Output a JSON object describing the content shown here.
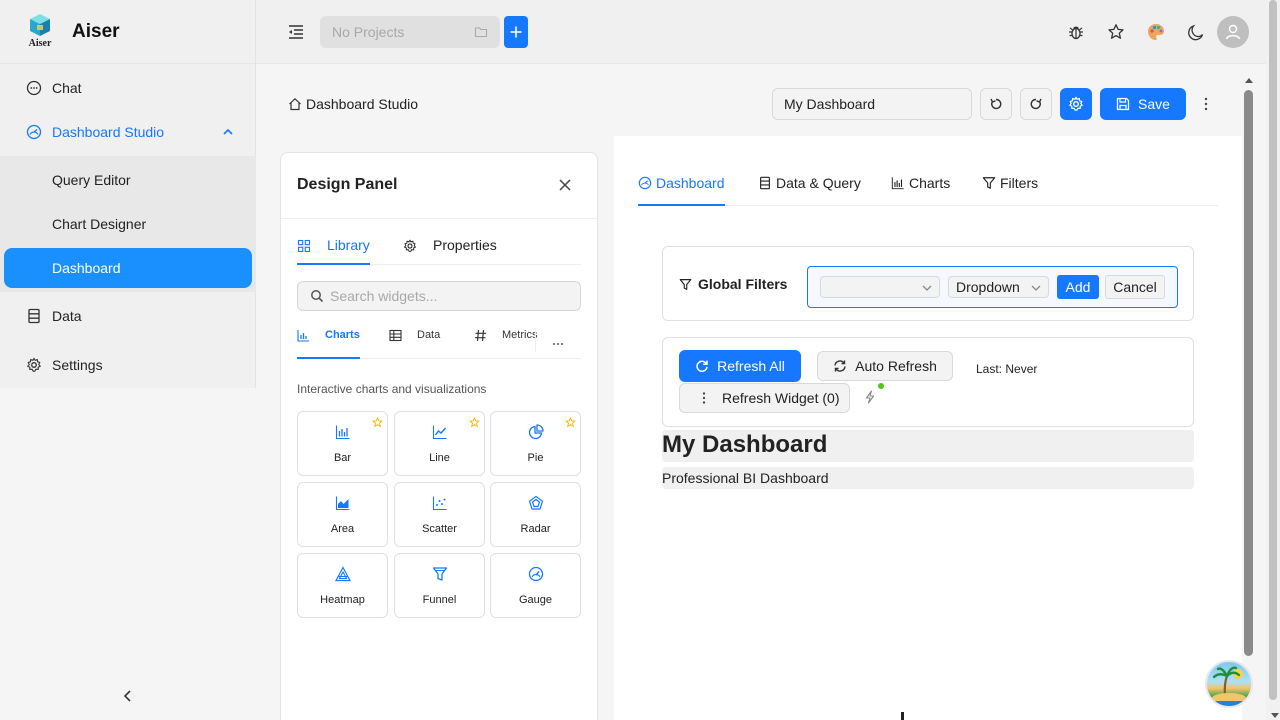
{
  "app": {
    "brand": "Aiser",
    "logo_subtext": "Aiser"
  },
  "sidebar": {
    "items": [
      {
        "label": "Chat",
        "icon": "chat-icon"
      },
      {
        "label": "Dashboard Studio",
        "icon": "dashboard-gauge-icon",
        "expanded": true
      },
      {
        "label": "Data",
        "icon": "database-icon"
      },
      {
        "label": "Settings",
        "icon": "gear-icon"
      }
    ],
    "submenu": [
      {
        "label": "Query Editor"
      },
      {
        "label": "Chart Designer"
      },
      {
        "label": "Dashboard",
        "selected": true
      }
    ]
  },
  "topbar": {
    "project_placeholder": "No Projects"
  },
  "header": {
    "breadcrumb": "Dashboard Studio",
    "dashboard_name": "My Dashboard",
    "save_label": "Save"
  },
  "design_panel": {
    "title": "Design Panel",
    "tabs": [
      {
        "label": "Library",
        "active": true
      },
      {
        "label": "Properties"
      }
    ],
    "search_placeholder": "Search widgets...",
    "categories": [
      {
        "label": "Charts",
        "active": true
      },
      {
        "label": "Data"
      },
      {
        "label": "Metrics"
      }
    ],
    "description": "Interactive charts and visualizations",
    "widgets": [
      {
        "label": "Bar",
        "icon": "bar-chart-icon",
        "starred": true
      },
      {
        "label": "Line",
        "icon": "line-chart-icon",
        "starred": true
      },
      {
        "label": "Pie",
        "icon": "pie-chart-icon",
        "starred": true
      },
      {
        "label": "Area",
        "icon": "area-chart-icon",
        "starred": false
      },
      {
        "label": "Scatter",
        "icon": "scatter-chart-icon",
        "starred": false
      },
      {
        "label": "Radar",
        "icon": "radar-chart-icon",
        "starred": false
      },
      {
        "label": "Heatmap",
        "icon": "heatmap-icon",
        "starred": false
      },
      {
        "label": "Funnel",
        "icon": "funnel-icon",
        "starred": false
      },
      {
        "label": "Gauge",
        "icon": "gauge-icon",
        "starred": false
      }
    ]
  },
  "dashboard": {
    "tabs": [
      {
        "label": "Dashboard",
        "active": true
      },
      {
        "label": "Data & Query"
      },
      {
        "label": "Charts"
      },
      {
        "label": "Filters"
      }
    ],
    "global_filters": {
      "label": "Global Filters",
      "field_value": "",
      "type_value": "Dropdown",
      "add_label": "Add",
      "cancel_label": "Cancel"
    },
    "controls": {
      "refresh_all": "Refresh All",
      "auto_refresh": "Auto Refresh",
      "last_refresh": "Last: Never",
      "refresh_widget": "Refresh Widget (0)"
    },
    "title": "My Dashboard",
    "subtitle": "Professional BI Dashboard"
  },
  "colors": {
    "accent": "#1677ff",
    "selected_nav": "#1a90ff",
    "star": "#f0b400",
    "status_dot": "#52c41a"
  }
}
